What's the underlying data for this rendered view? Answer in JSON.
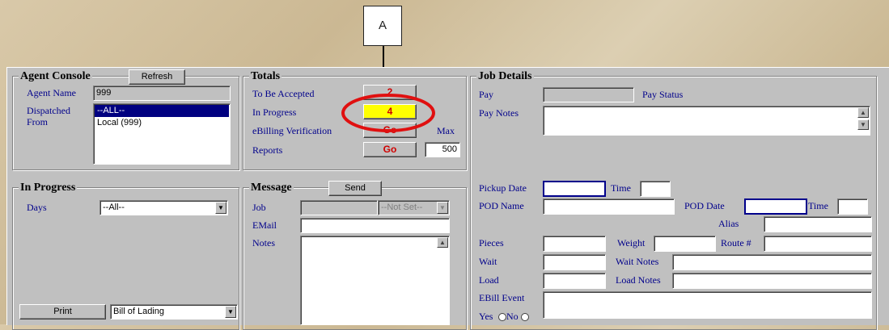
{
  "callout": {
    "label": "A"
  },
  "agent_console": {
    "title": "Agent Console",
    "refresh_label": "Refresh",
    "agent_name_label": "Agent Name",
    "agent_name_value": "999",
    "dispatched_label_1": "Dispatched",
    "dispatched_label_2": "From",
    "list_items": [
      "--ALL--",
      "Local (999)"
    ]
  },
  "totals": {
    "title": "Totals",
    "to_be_accepted_label": "To Be Accepted",
    "to_be_accepted_value": "2",
    "in_progress_label": "In Progress",
    "in_progress_value": "4",
    "ebilling_label": "eBilling Verification",
    "ebilling_button": "Go",
    "max_label": "Max",
    "reports_label": "Reports",
    "reports_button": "Go",
    "max_value": "500"
  },
  "in_progress": {
    "title": "In Progress",
    "days_label": "Days",
    "days_value": "--All--",
    "print_label": "Print",
    "print_doc_value": "Bill of Lading"
  },
  "message": {
    "title": "Message",
    "send_label": "Send",
    "job_label": "Job",
    "job_select_value": "--Not Set--",
    "email_label": "EMail",
    "notes_label": "Notes"
  },
  "job_details": {
    "title": "Job Details",
    "pay_label": "Pay",
    "pay_status_label": "Pay Status",
    "pay_notes_label": "Pay Notes",
    "pickup_date_label": "Pickup Date",
    "time_label": "Time",
    "pod_name_label": "POD Name",
    "pod_date_label": "POD Date",
    "pod_time_label": "Time",
    "alias_label": "Alias",
    "pieces_label": "Pieces",
    "weight_label": "Weight",
    "route_label": "Route #",
    "wait_label": "Wait",
    "wait_notes_label": "Wait Notes",
    "load_label": "Load",
    "load_notes_label": "Load Notes",
    "ebill_event_label": "EBill Event",
    "yes_label": "Yes",
    "no_label": "No"
  },
  "colors": {
    "highlight_circle": "#e01010",
    "go_text": "#d00000",
    "label_text": "#00008b"
  }
}
